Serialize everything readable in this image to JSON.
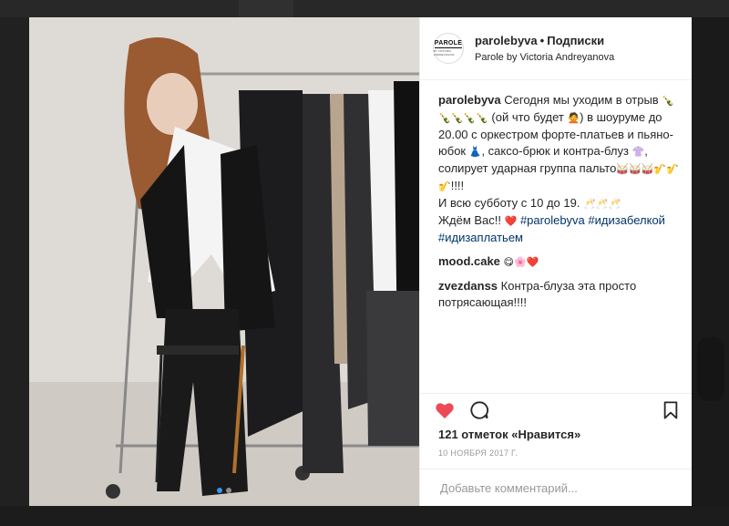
{
  "post": {
    "username": "parolebyva",
    "separator": "•",
    "follow_label": "Подписки",
    "subtitle": "Parole by Victoria Andreyanova",
    "avatar_brand": "PAROLE",
    "avatar_tagline": "BY VICTORIA ANDREYANOVA"
  },
  "caption": {
    "username": "parolebyva",
    "t1": "Сегодня мы уходим в отрыв",
    "e1": "🍾🍾🍾🍾🍾",
    "t2": "(ой что будет",
    "e2": "🙅",
    "t3": ") в шоуруме до 20.00 с оркестром форте-платьев и пьяно-юбок",
    "e3": "👗",
    "t4": ", саксо-брюк и контра-блуз",
    "e4": "👚",
    "t5": ", солирует ударная группа пальто",
    "e5": "🥁🥁🥁🎷🎷🎷",
    "t6": "!!!!",
    "t7": "И всю субботу с 10 до 19.",
    "e7": "🥂🥂🥂",
    "t8": "Ждём Вас!!",
    "e8": "❤️",
    "hashtag1": "#parolebyva",
    "hashtag2": "#идизабелкой",
    "hashtag3": "#идизаплатьем"
  },
  "comments": [
    {
      "username": "mood.cake",
      "text": "",
      "emoji": "😋🌸❤️"
    },
    {
      "username": "zvezdanss",
      "text": "Контра-блуза эта просто потрясающая!!!!",
      "emoji": ""
    }
  ],
  "actions": {
    "like_icon": "heart-icon",
    "comment_icon": "comment-icon",
    "save_icon": "bookmark-icon",
    "like_color": "#ed4956"
  },
  "likes_text": "121 отметок «Нравится»",
  "date": "10 НОЯБРЯ 2017 Г.",
  "add_comment_placeholder": "Добавьте комментарий...",
  "carousel": {
    "count": 2,
    "active": 1
  }
}
